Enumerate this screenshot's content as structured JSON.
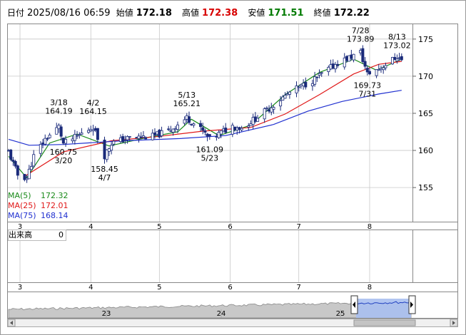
{
  "header": {
    "date_label": "日付",
    "datetime": "2025/08/16 06:59",
    "open_label": "始値",
    "open": "172.18",
    "high_label": "高値",
    "high": "172.38",
    "low_label": "安値",
    "low": "171.51",
    "close_label": "終値",
    "close": "172.22"
  },
  "moving_averages": [
    {
      "name": "MA(5)",
      "value": "172.32",
      "color": "#1a8a1a"
    },
    {
      "name": "MA(25)",
      "value": "172.01",
      "color": "#e01818"
    },
    {
      "name": "MA(75)",
      "value": "168.14",
      "color": "#2030d0"
    }
  ],
  "volume_panel": {
    "label": "出来高",
    "value": "0"
  },
  "colors": {
    "up": "#ffffff",
    "down": "#1a2a7a",
    "grid": "#c8c8c8",
    "navigator_fill": "#a8bff0"
  },
  "chart_data": [
    {
      "type": "candlestick",
      "ylim": [
        150.5,
        177
      ],
      "y_ticks": [
        155,
        160,
        165,
        170,
        175
      ],
      "x_tick_labels": [
        "3",
        "4",
        "5",
        "6",
        "7",
        "8"
      ],
      "x_tick_dates": [
        "2025-03-01",
        "2025-04-01",
        "2025-05-01",
        "2025-06-01",
        "2025-07-01",
        "2025-08-01"
      ],
      "xlim": [
        "2025-02-24",
        "2025-08-16"
      ],
      "grid": true,
      "anchors": [
        {
          "date": "2025-02-24",
          "close": 159.8
        },
        {
          "date": "2025-02-28",
          "close": 156.7
        },
        {
          "date": "2025-03-04",
          "close": 156.3
        },
        {
          "date": "2025-03-07",
          "close": 159.2
        },
        {
          "date": "2025-03-12",
          "close": 161.5
        },
        {
          "date": "2025-03-18",
          "close": 163.2
        },
        {
          "date": "2025-03-20",
          "close": 160.9
        },
        {
          "date": "2025-03-26",
          "close": 161.9
        },
        {
          "date": "2025-04-02",
          "close": 163.2
        },
        {
          "date": "2025-04-07",
          "close": 159.3
        },
        {
          "date": "2025-04-10",
          "close": 161.0
        },
        {
          "date": "2025-04-18",
          "close": 161.7
        },
        {
          "date": "2025-04-28",
          "close": 161.9
        },
        {
          "date": "2025-05-05",
          "close": 162.6
        },
        {
          "date": "2025-05-13",
          "close": 164.4
        },
        {
          "date": "2025-05-20",
          "close": 162.6
        },
        {
          "date": "2025-05-23",
          "close": 161.5
        },
        {
          "date": "2025-06-02",
          "close": 163.3
        },
        {
          "date": "2025-06-06",
          "close": 163.0
        },
        {
          "date": "2025-06-16",
          "close": 165.2
        },
        {
          "date": "2025-06-27",
          "close": 167.8
        },
        {
          "date": "2025-07-08",
          "close": 169.6
        },
        {
          "date": "2025-07-18",
          "close": 171.8
        },
        {
          "date": "2025-07-28",
          "close": 173.2
        },
        {
          "date": "2025-07-31",
          "close": 170.3
        },
        {
          "date": "2025-08-05",
          "close": 171.0
        },
        {
          "date": "2025-08-13",
          "close": 172.6
        },
        {
          "date": "2025-08-15",
          "close": 172.2
        }
      ],
      "moving_averages": [
        {
          "name": "MA(5)",
          "points": [
            [
              "2025-02-24",
              159.2
            ],
            [
              "2025-03-04",
              156.3
            ],
            [
              "2025-03-14",
              161.0
            ],
            [
              "2025-03-26",
              162.2
            ],
            [
              "2025-04-09",
              160.6
            ],
            [
              "2025-04-25",
              161.7
            ],
            [
              "2025-05-09",
              162.5
            ],
            [
              "2025-05-15",
              164.2
            ],
            [
              "2025-05-27",
              162.0
            ],
            [
              "2025-06-10",
              163.4
            ],
            [
              "2025-06-25",
              167.5
            ],
            [
              "2025-07-10",
              170.5
            ],
            [
              "2025-07-25",
              172.3
            ],
            [
              "2025-08-04",
              170.8
            ],
            [
              "2025-08-15",
              172.3
            ]
          ]
        },
        {
          "name": "MA(25)",
          "points": [
            [
              "2025-03-03",
              156.5
            ],
            [
              "2025-03-20",
              159.8
            ],
            [
              "2025-04-10",
              161.3
            ],
            [
              "2025-05-01",
              161.9
            ],
            [
              "2025-05-20",
              162.6
            ],
            [
              "2025-06-10",
              163.1
            ],
            [
              "2025-06-25",
              164.9
            ],
            [
              "2025-07-10",
              167.5
            ],
            [
              "2025-07-25",
              170.3
            ],
            [
              "2025-08-05",
              171.6
            ],
            [
              "2025-08-15",
              172.0
            ]
          ]
        },
        {
          "name": "MA(75)",
          "points": [
            [
              "2025-02-24",
              161.5
            ],
            [
              "2025-03-05",
              160.7
            ],
            [
              "2025-03-20",
              160.8
            ],
            [
              "2025-04-15",
              161.3
            ],
            [
              "2025-05-10",
              161.6
            ],
            [
              "2025-05-30",
              162.0
            ],
            [
              "2025-06-20",
              163.5
            ],
            [
              "2025-07-05",
              165.3
            ],
            [
              "2025-07-20",
              166.6
            ],
            [
              "2025-08-05",
              167.6
            ],
            [
              "2025-08-15",
              168.1
            ]
          ]
        }
      ],
      "annotations": [
        {
          "date": "2025-03-18",
          "value": "3/18",
          "price": "164.19",
          "kind": "high"
        },
        {
          "date": "2025-04-02",
          "value": "4/2",
          "price": "164.15",
          "kind": "high"
        },
        {
          "date": "2025-05-13",
          "value": "5/13",
          "price": "165.21",
          "kind": "high"
        },
        {
          "date": "2025-07-28",
          "value": "7/28",
          "price": "173.89",
          "kind": "high"
        },
        {
          "date": "2025-08-13",
          "value": "8/13",
          "price": "173.02",
          "kind": "high"
        },
        {
          "date": "2025-03-20",
          "value": "3/20",
          "price": "160.75",
          "kind": "low"
        },
        {
          "date": "2025-04-07",
          "value": "4/7",
          "price": "158.45",
          "kind": "low"
        },
        {
          "date": "2025-05-23",
          "value": "5/23",
          "price": "161.09",
          "kind": "low"
        },
        {
          "date": "2025-07-31",
          "value": "7/31",
          "price": "169.73",
          "kind": "low"
        }
      ]
    },
    {
      "type": "bar",
      "title": "出来高",
      "values": [
        0
      ]
    },
    {
      "type": "area",
      "x_tick_labels": [
        "23",
        "24",
        "25"
      ],
      "selection": "right-end"
    }
  ]
}
